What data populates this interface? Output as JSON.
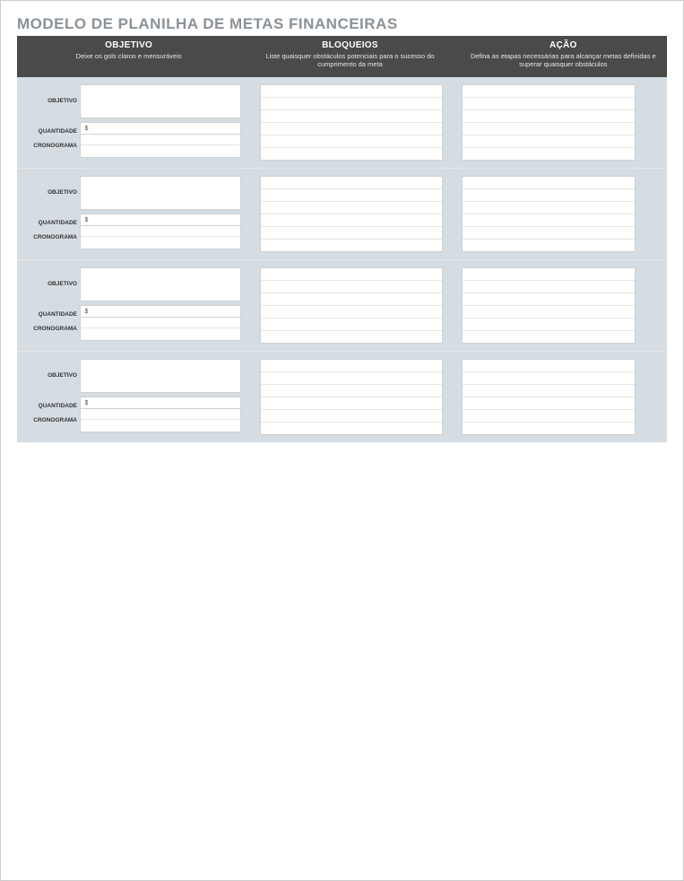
{
  "page_title": "MODELO DE PLANILHA DE METAS FINANCEIRAS",
  "headers": {
    "objetivo": {
      "label": "OBJETIVO",
      "sub": "Deixe os gols claros e mensuráveis"
    },
    "bloqueios": {
      "label": "BLOQUEIOS",
      "sub": "Liste quaisquer obstáculos potenciais para o sucesso do cumprimento da meta"
    },
    "acao": {
      "label": "AÇÃO",
      "sub": "Defina as etapas necessárias para alcançar metas definidas e superar quaisquer obstáculos"
    }
  },
  "row_labels": {
    "objetivo": "OBJETIVO",
    "quantidade": "QUANTIDADE",
    "cronograma": "CRONOGRAMA"
  },
  "currency_symbol": "$",
  "goal_blocks": [
    {
      "objetivo": "",
      "quantidade": "",
      "cronograma": [
        "",
        ""
      ],
      "bloqueios": [
        "",
        "",
        "",
        "",
        "",
        ""
      ],
      "acao": [
        "",
        "",
        "",
        "",
        "",
        ""
      ]
    },
    {
      "objetivo": "",
      "quantidade": "",
      "cronograma": [
        "",
        ""
      ],
      "bloqueios": [
        "",
        "",
        "",
        "",
        "",
        ""
      ],
      "acao": [
        "",
        "",
        "",
        "",
        "",
        ""
      ]
    },
    {
      "objetivo": "",
      "quantidade": "",
      "cronograma": [
        "",
        ""
      ],
      "bloqueios": [
        "",
        "",
        "",
        "",
        "",
        ""
      ],
      "acao": [
        "",
        "",
        "",
        "",
        "",
        ""
      ]
    },
    {
      "objetivo": "",
      "quantidade": "",
      "cronograma": [
        "",
        ""
      ],
      "bloqueios": [
        "",
        "",
        "",
        "",
        "",
        ""
      ],
      "acao": [
        "",
        "",
        "",
        "",
        "",
        ""
      ]
    }
  ]
}
